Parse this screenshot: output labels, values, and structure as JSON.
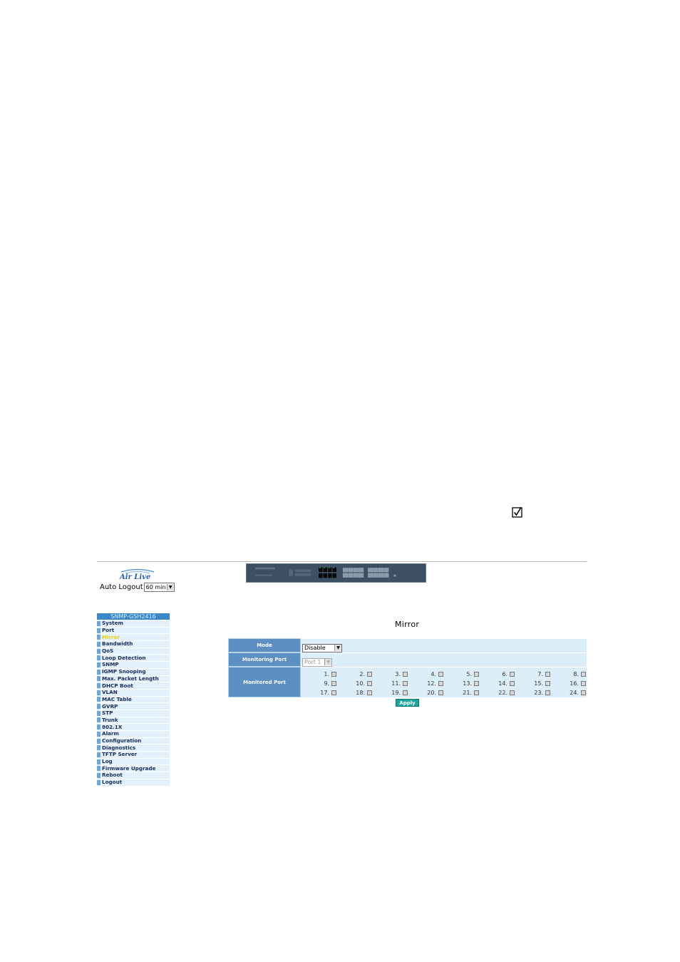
{
  "brand": {
    "logo_text": "Air Live"
  },
  "header": {
    "auto_logout_label": "Auto Logout",
    "auto_logout_value": "60 min"
  },
  "sidebar": {
    "title": "SNMP-GSH2416",
    "active": "Mirror",
    "items": [
      {
        "label": "System"
      },
      {
        "label": "Port"
      },
      {
        "label": "Mirror"
      },
      {
        "label": "Bandwidth"
      },
      {
        "label": "QoS"
      },
      {
        "label": "Loop Detection"
      },
      {
        "label": "SNMP"
      },
      {
        "label": "IGMP Snooping"
      },
      {
        "label": "Max. Packet Length"
      },
      {
        "label": "DHCP Boot"
      },
      {
        "label": "VLAN"
      },
      {
        "label": "MAC Table"
      },
      {
        "label": "GVRP"
      },
      {
        "label": "STP"
      },
      {
        "label": "Trunk"
      },
      {
        "label": "802.1X"
      },
      {
        "label": "Alarm"
      },
      {
        "label": "Configuration"
      },
      {
        "label": "Diagnostics"
      },
      {
        "label": "TFTP Server"
      },
      {
        "label": "Log"
      },
      {
        "label": "Firmware Upgrade"
      },
      {
        "label": "Reboot"
      },
      {
        "label": "Logout"
      }
    ]
  },
  "main": {
    "title": "Mirror",
    "mode_label": "Mode",
    "mode_value": "Disable",
    "monitoring_port_label": "Monitoring Port",
    "monitoring_port_value": "Port 1",
    "monitored_port_label": "Monitored Port",
    "ports": [
      "1.",
      "2.",
      "3.",
      "4.",
      "5.",
      "6.",
      "7.",
      "8.",
      "9.",
      "10.",
      "11.",
      "12.",
      "13.",
      "14.",
      "15.",
      "16.",
      "17.",
      "18.",
      "19.",
      "20.",
      "21.",
      "22.",
      "23.",
      "24."
    ],
    "ports_checked": [
      false,
      false,
      false,
      false,
      false,
      false,
      false,
      false,
      false,
      false,
      false,
      false,
      false,
      false,
      false,
      false,
      false,
      false,
      false,
      false,
      false,
      false,
      false,
      false
    ],
    "apply_label": "Apply"
  },
  "colors": {
    "sidebar_header": "#3a88c8",
    "label_cell": "#5e8fc3",
    "value_cell": "#ddeefb",
    "active_item": "#e8d010",
    "apply_button": "#1aa69a"
  },
  "icons": {
    "top_right": "checkmark-box-icon",
    "logo": "airlive-logo",
    "device": "switch-front-panel-image"
  }
}
